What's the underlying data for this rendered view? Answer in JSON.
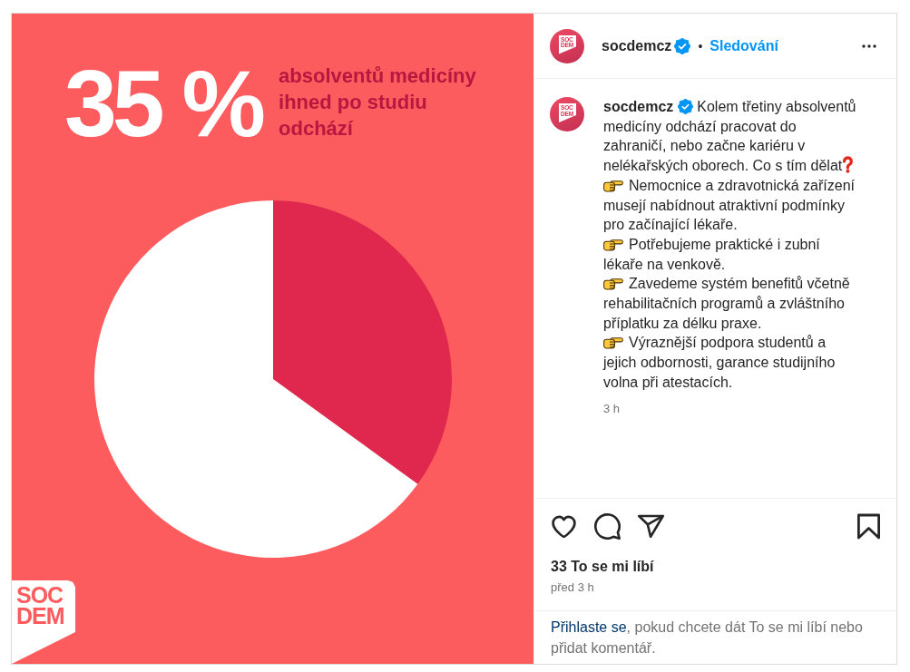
{
  "image": {
    "headline": "35 %",
    "subtitle": "absolventů medicíny ihned po studiu odchází",
    "chart_data": {
      "type": "pie",
      "values": [
        35,
        65
      ]
    },
    "logo_lines": [
      "SOC",
      "DEM"
    ]
  },
  "header": {
    "avatar_lines": [
      "SOC",
      "DEM"
    ],
    "username": "socdemcz",
    "verified": true,
    "separator": "•",
    "follow": "Sledování"
  },
  "caption": {
    "avatar_lines": [
      "SOC",
      "DEM"
    ],
    "username": "socdemcz",
    "verified": true,
    "text": "Kolem třetiny absolventů medicíny odchází pracovat do zahraničí, nebo začne kariéru v nelékařských oborech. Co s tím dělat",
    "bullets": [
      "Nemocnice a zdravotnická zařízení musejí nabídnout atraktivní podmínky pro začínající lékaře.",
      "Potřebujeme praktické i zubní lékaře na venkově.",
      "Zavedeme systém benefitů včetně rehabilitačních programů a zvláštního příplatku za délku praxe.",
      "Výraznější podpora studentů a jejich odbornosti, garance studijního volna při atestacích."
    ],
    "time": "3 h"
  },
  "actions": {
    "liked": false,
    "saved": false,
    "likes": "33 To se mi líbí",
    "date": "před 3 h"
  },
  "login_prompt": {
    "link": "Přihlaste se",
    "text": ", pokud chcete dát To se mi líbí nebo přidat komentář."
  }
}
